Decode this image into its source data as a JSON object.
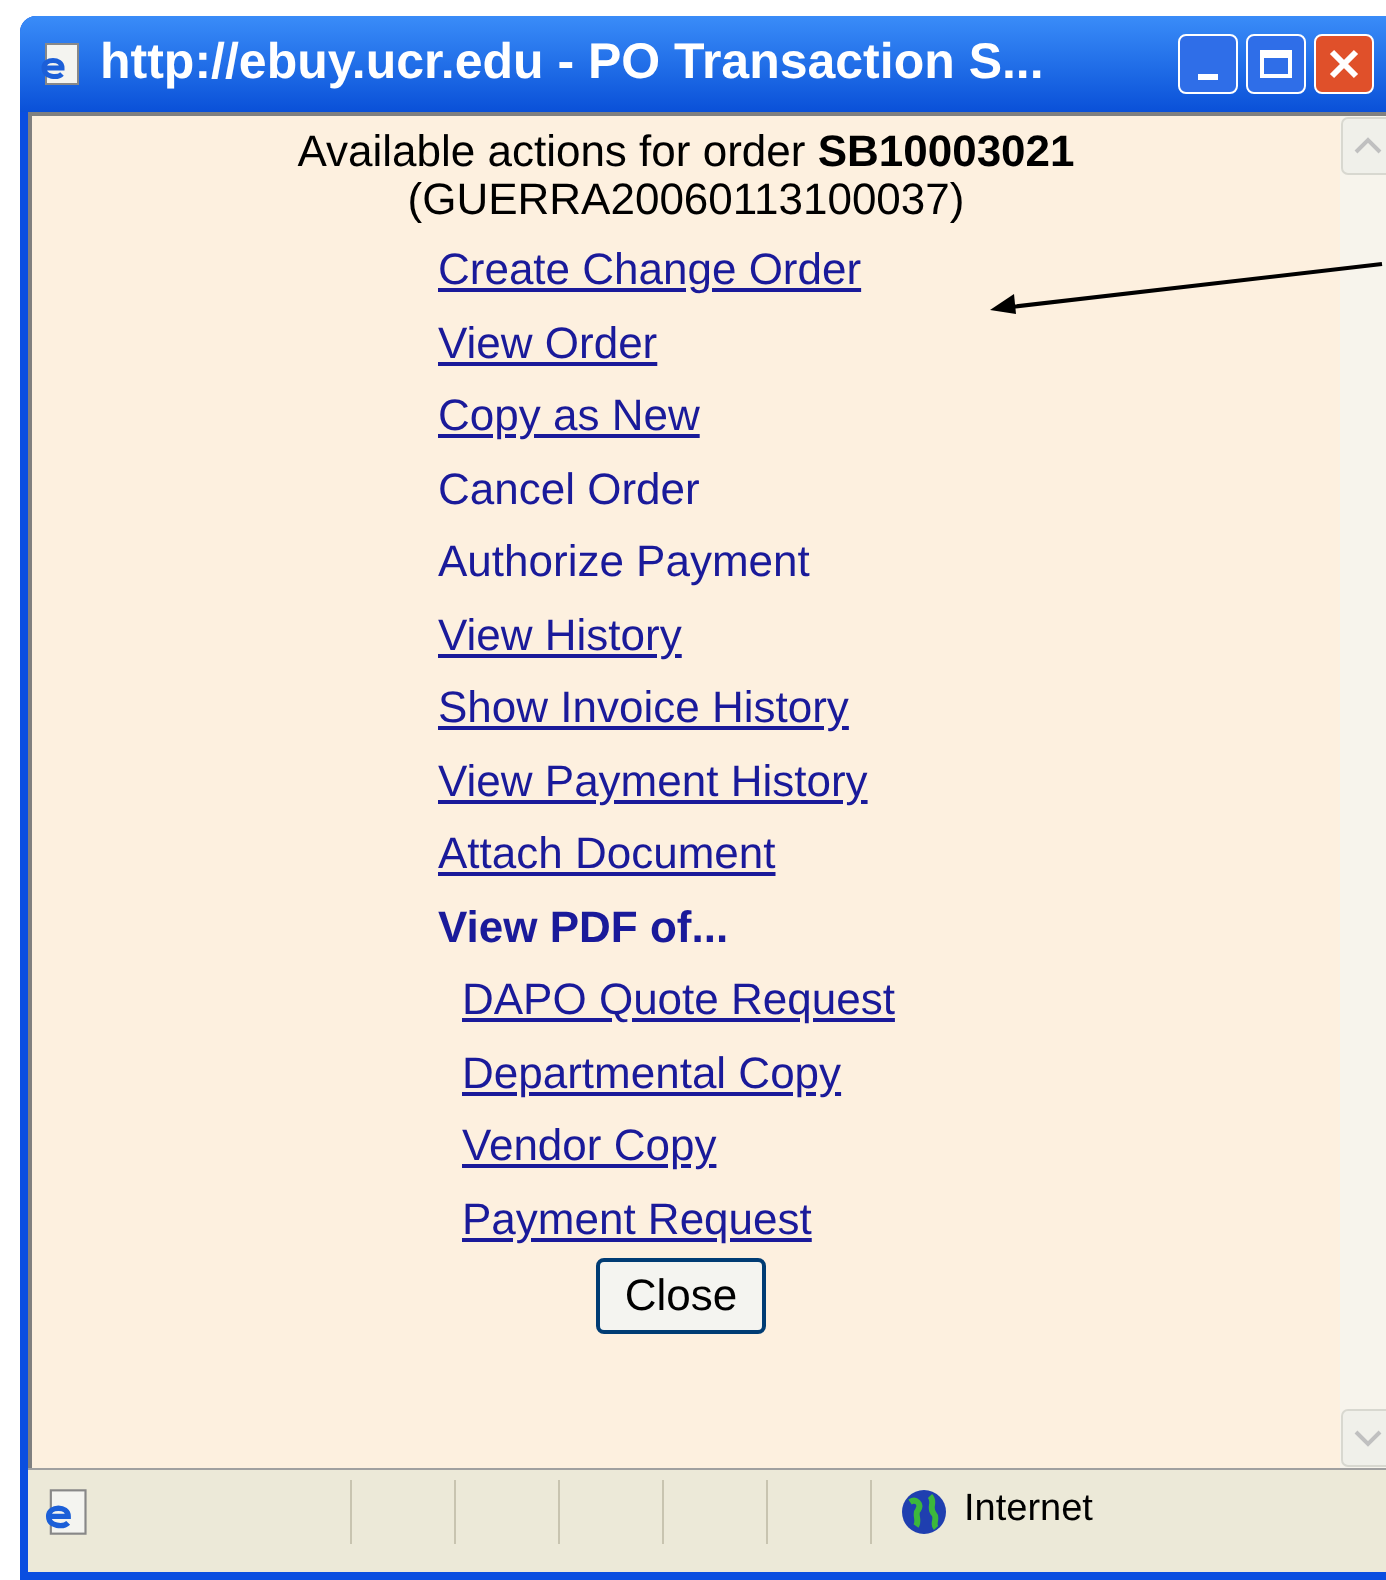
{
  "window": {
    "title": "http://ebuy.ucr.edu - PO Transaction S..."
  },
  "header": {
    "line_1": "Available actions for order **SB10003021**",
    "line_2": "(GUERRA20060113100037)"
  },
  "actions": [
    {
      "label": "Create Change Order",
      "underlined": true
    },
    {
      "label": "View Order",
      "underlined": true
    },
    {
      "label": "Copy as New",
      "underlined": true
    },
    {
      "label": "Cancel Order",
      "underlined": false
    },
    {
      "label": "Authorize Payment",
      "underlined": false
    },
    {
      "label": "View History",
      "underlined": true
    },
    {
      "label": "Show Invoice History",
      "underlined": true
    },
    {
      "label": "View Payment History",
      "underlined": true
    },
    {
      "label": "Attach Document",
      "underlined": true
    },
    {
      "label": "View PDF of...",
      "underlined": false,
      "children": [
        {
          "label": "DAPO Quote Request",
          "underlined": true
        },
        {
          "label": "Departmental Copy",
          "underlined": true
        },
        {
          "label": "Vendor Copy",
          "underlined": true
        },
        {
          "label": "Payment Request",
          "underlined": true
        }
      ]
    }
  ],
  "close_button": "Close",
  "status_bar": {
    "zone": "Internet"
  }
}
